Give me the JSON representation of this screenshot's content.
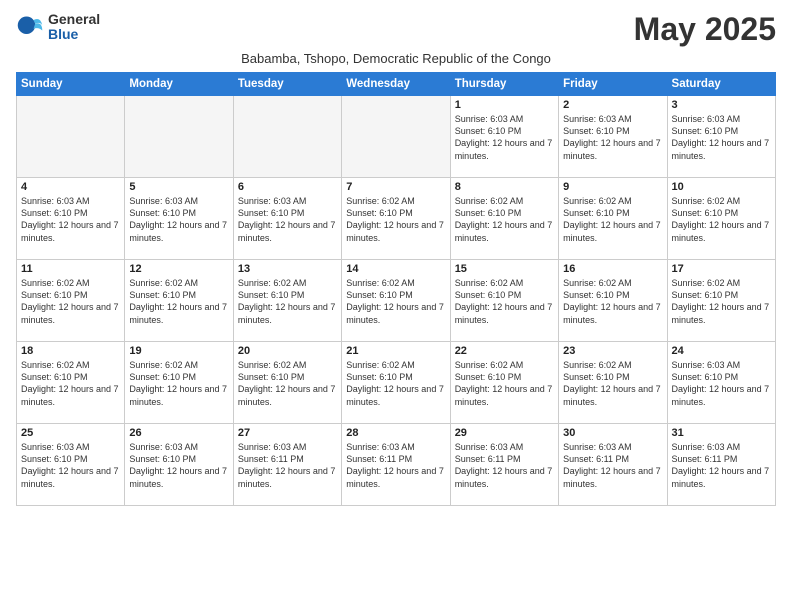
{
  "logo": {
    "general": "General",
    "blue": "Blue"
  },
  "header": {
    "month_year": "May 2025",
    "subtitle": "Babamba, Tshopo, Democratic Republic of the Congo"
  },
  "weekdays": [
    "Sunday",
    "Monday",
    "Tuesday",
    "Wednesday",
    "Thursday",
    "Friday",
    "Saturday"
  ],
  "rows": [
    [
      {
        "day": "",
        "empty": true
      },
      {
        "day": "",
        "empty": true
      },
      {
        "day": "",
        "empty": true
      },
      {
        "day": "",
        "empty": true
      },
      {
        "day": "1",
        "sunrise": "6:03 AM",
        "sunset": "6:10 PM",
        "daylight": "12 hours and 7 minutes."
      },
      {
        "day": "2",
        "sunrise": "6:03 AM",
        "sunset": "6:10 PM",
        "daylight": "12 hours and 7 minutes."
      },
      {
        "day": "3",
        "sunrise": "6:03 AM",
        "sunset": "6:10 PM",
        "daylight": "12 hours and 7 minutes."
      }
    ],
    [
      {
        "day": "4",
        "sunrise": "6:03 AM",
        "sunset": "6:10 PM",
        "daylight": "12 hours and 7 minutes."
      },
      {
        "day": "5",
        "sunrise": "6:03 AM",
        "sunset": "6:10 PM",
        "daylight": "12 hours and 7 minutes."
      },
      {
        "day": "6",
        "sunrise": "6:03 AM",
        "sunset": "6:10 PM",
        "daylight": "12 hours and 7 minutes."
      },
      {
        "day": "7",
        "sunrise": "6:02 AM",
        "sunset": "6:10 PM",
        "daylight": "12 hours and 7 minutes."
      },
      {
        "day": "8",
        "sunrise": "6:02 AM",
        "sunset": "6:10 PM",
        "daylight": "12 hours and 7 minutes."
      },
      {
        "day": "9",
        "sunrise": "6:02 AM",
        "sunset": "6:10 PM",
        "daylight": "12 hours and 7 minutes."
      },
      {
        "day": "10",
        "sunrise": "6:02 AM",
        "sunset": "6:10 PM",
        "daylight": "12 hours and 7 minutes."
      }
    ],
    [
      {
        "day": "11",
        "sunrise": "6:02 AM",
        "sunset": "6:10 PM",
        "daylight": "12 hours and 7 minutes."
      },
      {
        "day": "12",
        "sunrise": "6:02 AM",
        "sunset": "6:10 PM",
        "daylight": "12 hours and 7 minutes."
      },
      {
        "day": "13",
        "sunrise": "6:02 AM",
        "sunset": "6:10 PM",
        "daylight": "12 hours and 7 minutes."
      },
      {
        "day": "14",
        "sunrise": "6:02 AM",
        "sunset": "6:10 PM",
        "daylight": "12 hours and 7 minutes."
      },
      {
        "day": "15",
        "sunrise": "6:02 AM",
        "sunset": "6:10 PM",
        "daylight": "12 hours and 7 minutes."
      },
      {
        "day": "16",
        "sunrise": "6:02 AM",
        "sunset": "6:10 PM",
        "daylight": "12 hours and 7 minutes."
      },
      {
        "day": "17",
        "sunrise": "6:02 AM",
        "sunset": "6:10 PM",
        "daylight": "12 hours and 7 minutes."
      }
    ],
    [
      {
        "day": "18",
        "sunrise": "6:02 AM",
        "sunset": "6:10 PM",
        "daylight": "12 hours and 7 minutes."
      },
      {
        "day": "19",
        "sunrise": "6:02 AM",
        "sunset": "6:10 PM",
        "daylight": "12 hours and 7 minutes."
      },
      {
        "day": "20",
        "sunrise": "6:02 AM",
        "sunset": "6:10 PM",
        "daylight": "12 hours and 7 minutes."
      },
      {
        "day": "21",
        "sunrise": "6:02 AM",
        "sunset": "6:10 PM",
        "daylight": "12 hours and 7 minutes."
      },
      {
        "day": "22",
        "sunrise": "6:02 AM",
        "sunset": "6:10 PM",
        "daylight": "12 hours and 7 minutes."
      },
      {
        "day": "23",
        "sunrise": "6:02 AM",
        "sunset": "6:10 PM",
        "daylight": "12 hours and 7 minutes."
      },
      {
        "day": "24",
        "sunrise": "6:03 AM",
        "sunset": "6:10 PM",
        "daylight": "12 hours and 7 minutes."
      }
    ],
    [
      {
        "day": "25",
        "sunrise": "6:03 AM",
        "sunset": "6:10 PM",
        "daylight": "12 hours and 7 minutes."
      },
      {
        "day": "26",
        "sunrise": "6:03 AM",
        "sunset": "6:10 PM",
        "daylight": "12 hours and 7 minutes."
      },
      {
        "day": "27",
        "sunrise": "6:03 AM",
        "sunset": "6:11 PM",
        "daylight": "12 hours and 7 minutes."
      },
      {
        "day": "28",
        "sunrise": "6:03 AM",
        "sunset": "6:11 PM",
        "daylight": "12 hours and 7 minutes."
      },
      {
        "day": "29",
        "sunrise": "6:03 AM",
        "sunset": "6:11 PM",
        "daylight": "12 hours and 7 minutes."
      },
      {
        "day": "30",
        "sunrise": "6:03 AM",
        "sunset": "6:11 PM",
        "daylight": "12 hours and 7 minutes."
      },
      {
        "day": "31",
        "sunrise": "6:03 AM",
        "sunset": "6:11 PM",
        "daylight": "12 hours and 7 minutes."
      }
    ]
  ]
}
